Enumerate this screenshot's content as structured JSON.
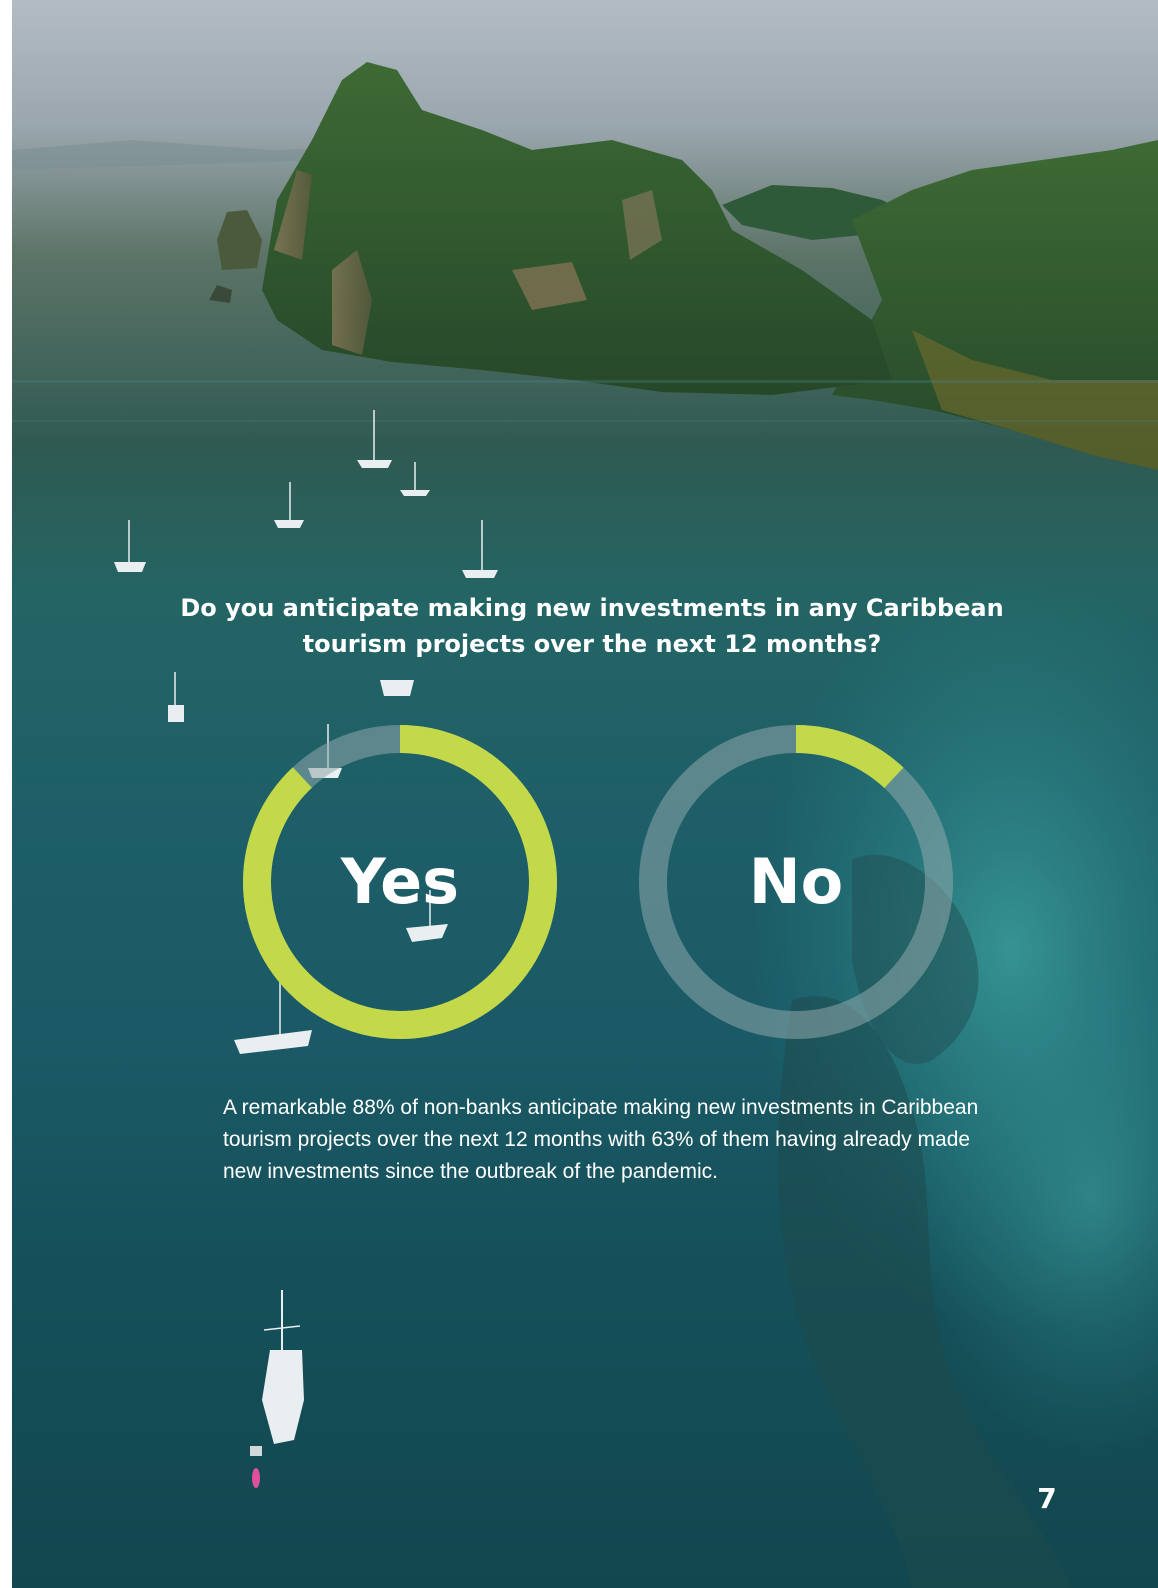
{
  "question": "Do you anticipate making new investments in any Caribbean tourism projects over the next 12 months?",
  "chart_data": [
    {
      "type": "pie",
      "label": "Yes",
      "value_percent": 88,
      "color": "#c3d94a",
      "track_color": "#8fa8ab"
    },
    {
      "type": "pie",
      "label": "No",
      "value_percent": 12,
      "color": "#c3d94a",
      "track_color": "#8fa8ab"
    }
  ],
  "body_text": "A remarkable 88% of non-banks anticipate making new investments in Caribbean tourism projects over the next 12 months with 63% of them having already made new investments since the outbreak of the pandemic.",
  "page_number": "7",
  "colors": {
    "accent": "#c3d94a",
    "text": "#ffffff",
    "sea": "#1d5e68",
    "island": "#2f5a2e"
  }
}
